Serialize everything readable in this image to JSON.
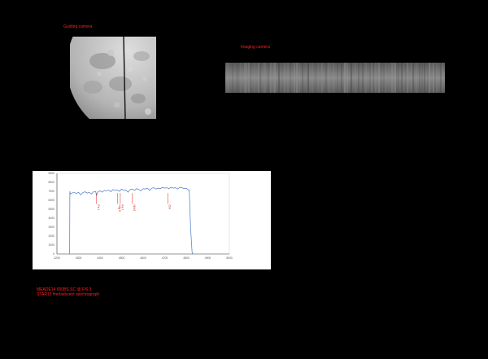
{
  "labels": {
    "guiding": "Guiding camera",
    "imaging": "Imaging camera"
  },
  "caption": {
    "line1": "MEADE14 000BS SC @ F/6.3",
    "line2": "STAR13 Herbalscent spectrograph"
  },
  "chart_data": {
    "type": "line",
    "title": "",
    "xlabel": "",
    "ylabel": "",
    "xlim": [
      4200,
      5000
    ],
    "ylim": [
      0,
      9000
    ],
    "x_ticks": [
      "4200",
      "4300",
      "4400",
      "4500",
      "4600",
      "4700",
      "4800",
      "4900",
      "5000"
    ],
    "y_ticks": [
      "0",
      "1000",
      "2000",
      "3000",
      "4000",
      "5000",
      "6000",
      "7000",
      "8000",
      "9000"
    ],
    "grid": false,
    "series": [
      {
        "color": "#4a78c4",
        "x": [
          4259,
          4260,
          4262,
          4270,
          4280,
          4290,
          4300,
          4310,
          4320,
          4330,
          4340,
          4350,
          4360,
          4370,
          4380,
          4383,
          4390,
          4400,
          4410,
          4420,
          4430,
          4440,
          4450,
          4460,
          4470,
          4480,
          4490,
          4500,
          4510,
          4520,
          4530,
          4540,
          4550,
          4560,
          4570,
          4580,
          4590,
          4600,
          4610,
          4620,
          4630,
          4640,
          4650,
          4660,
          4670,
          4680,
          4690,
          4700,
          4710,
          4720,
          4730,
          4740,
          4750,
          4760,
          4770,
          4780,
          4790,
          4800,
          4810,
          4814,
          4820,
          4827,
          4830
        ],
        "values": [
          0,
          7000,
          6700,
          6800,
          6900,
          6750,
          6900,
          6600,
          6850,
          6950,
          6800,
          6900,
          6700,
          6950,
          7000,
          6500,
          6950,
          7050,
          6900,
          7100,
          7050,
          7150,
          6950,
          7200,
          7100,
          7150,
          7000,
          7250,
          7100,
          7150,
          6900,
          7200,
          7250,
          7100,
          7300,
          7200,
          7050,
          7300,
          7250,
          7350,
          7100,
          7350,
          7400,
          7250,
          7350,
          7300,
          7450,
          7350,
          7400,
          7300,
          7450,
          7350,
          7400,
          7250,
          7450,
          7400,
          7300,
          7350,
          7150,
          7100,
          3000,
          200,
          0
        ]
      }
    ],
    "annotations": [
      {
        "label": "Fe I",
        "x": 4383
      },
      {
        "label": "Mg II",
        "x": 4481
      },
      {
        "label": "Fe I",
        "x": 4494
      },
      {
        "label": "NH2",
        "x": 4550
      },
      {
        "label": "CH",
        "x": 4714
      }
    ]
  }
}
